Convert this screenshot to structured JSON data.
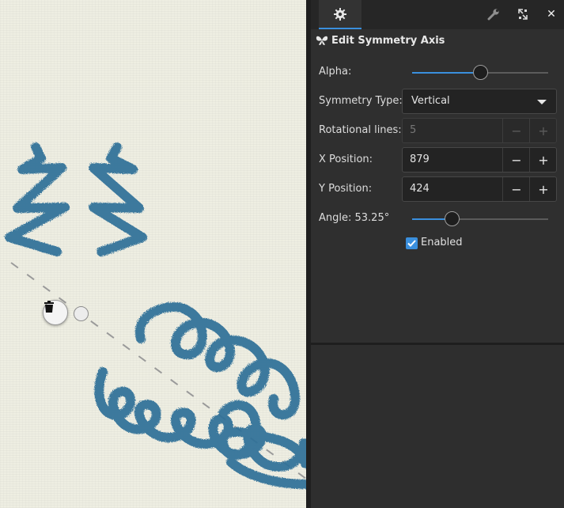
{
  "panel": {
    "title": "Edit Symmetry Axis",
    "title_icon": "butterfly-icon",
    "tabs": [
      {
        "icon": "gear-icon",
        "active": true
      }
    ],
    "toolbar_icons": [
      "wrench-icon",
      "swap-arrows-icon",
      "close-icon"
    ],
    "close_label": "✕"
  },
  "fields": {
    "alpha": {
      "label": "Alpha:",
      "value_fraction": 0.51
    },
    "symmetry_type": {
      "label": "Symmetry Type:",
      "value": "Vertical"
    },
    "rotational_lines": {
      "label": "Rotational lines:",
      "value": "5",
      "disabled": true
    },
    "x_position": {
      "label": "X Position:",
      "value": "879"
    },
    "y_position": {
      "label": "Y Position:",
      "value": "424"
    },
    "angle": {
      "label": "Angle: 53.25°",
      "value_degrees": 53.25,
      "value_fraction": 0.3
    },
    "enabled": {
      "label": "Enabled",
      "checked": true
    }
  },
  "stepper": {
    "minus": "−",
    "plus": "+"
  },
  "canvas": {
    "stroke_color": "#2f6f98",
    "axis_color": "#9a9a9a"
  },
  "colors": {
    "accent": "#3a8fdd"
  }
}
